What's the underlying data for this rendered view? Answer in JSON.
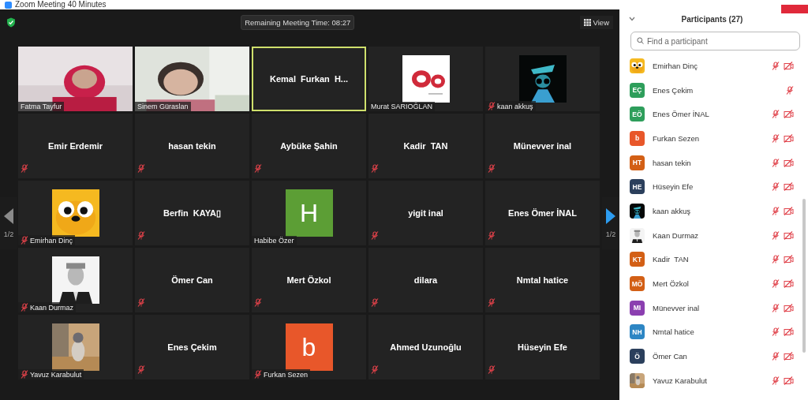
{
  "window": {
    "title": "Zoom Meeting 40 Minutes"
  },
  "top_bar": {
    "timer": "Remaining Meeting Time: 08:27",
    "view_button": "View"
  },
  "pager": {
    "prev": {
      "label": "1/2",
      "disabled": true
    },
    "next": {
      "label": "1/2",
      "disabled": false
    }
  },
  "tiles": [
    {
      "kind": "video",
      "name": "Fatma Tayfur",
      "muted": false,
      "speaking": false
    },
    {
      "kind": "video",
      "name": "Sinem Güraslan",
      "muted": false,
      "speaking": false
    },
    {
      "kind": "name",
      "name": "Kemal  Furkan  H...",
      "muted": false,
      "speaking": true
    },
    {
      "kind": "picture",
      "name": "Murat SARIOĞLAN",
      "muted": false,
      "speaking": false
    },
    {
      "kind": "picture",
      "name": "kaan akkuş",
      "muted": true,
      "speaking": false
    },
    {
      "kind": "name",
      "name": "Emir Erdemir",
      "muted": true,
      "speaking": false
    },
    {
      "kind": "name",
      "name": "hasan tekin",
      "muted": true,
      "speaking": false
    },
    {
      "kind": "name",
      "name": "Aybüke Şahin",
      "muted": true,
      "speaking": false
    },
    {
      "kind": "name",
      "name": "Kadir  TAN",
      "muted": true,
      "speaking": false
    },
    {
      "kind": "name",
      "name": "Münevver inal",
      "muted": true,
      "speaking": false
    },
    {
      "kind": "picture",
      "name": "Emirhan Dinç",
      "muted": true,
      "speaking": false
    },
    {
      "kind": "name",
      "name": "Berfin  KAYA▯",
      "muted": true,
      "speaking": false
    },
    {
      "kind": "letter",
      "letter": "H",
      "color": "#5c9e35",
      "name": "Habibe Özer",
      "muted": false,
      "speaking": false
    },
    {
      "kind": "name",
      "name": "yigit inal",
      "muted": true,
      "speaking": false
    },
    {
      "kind": "name",
      "name": "Enes Ömer İNAL",
      "muted": true,
      "speaking": false
    },
    {
      "kind": "picture",
      "name": "Kaan Durmaz",
      "muted": true,
      "speaking": false
    },
    {
      "kind": "name",
      "name": "Ömer Can",
      "muted": true,
      "speaking": false
    },
    {
      "kind": "name",
      "name": "Mert Özkol",
      "muted": true,
      "speaking": false
    },
    {
      "kind": "name",
      "name": "dilara",
      "muted": true,
      "speaking": false
    },
    {
      "kind": "name",
      "name": "Nmtal hatice",
      "muted": true,
      "speaking": false
    },
    {
      "kind": "picture",
      "name": "Yavuz Karabulut",
      "muted": true,
      "speaking": false
    },
    {
      "kind": "name",
      "name": "Enes Çekim",
      "muted": true,
      "speaking": false
    },
    {
      "kind": "letter",
      "letter": "b",
      "color": "#e8572a",
      "name": "Furkan Sezen",
      "muted": true,
      "speaking": false
    },
    {
      "kind": "name",
      "name": "Ahmed Uzunoğlu",
      "muted": true,
      "speaking": false
    },
    {
      "kind": "name",
      "name": "Hüseyin Efe",
      "muted": true,
      "speaking": false
    }
  ],
  "participants": {
    "title": "Participants (27)",
    "search": {
      "placeholder": "Find a participant"
    },
    "items": [
      {
        "name": "Emirhan Dinç",
        "muted": true,
        "video_off": true
      },
      {
        "name": "Enes Çekim",
        "avatar": {
          "kind": "initials",
          "text": "EÇ",
          "color": "#2e9e5b"
        },
        "muted": true,
        "video_off": false
      },
      {
        "name": "Enes Ömer İNAL",
        "avatar": {
          "kind": "initials",
          "text": "EÖ",
          "color": "#2e9e5b"
        },
        "muted": true,
        "video_off": true
      },
      {
        "name": "Furkan Sezen",
        "avatar": {
          "kind": "initials",
          "text": "b",
          "color": "#e8572a"
        },
        "muted": true,
        "video_off": true
      },
      {
        "name": "hasan tekin",
        "avatar": {
          "kind": "initials",
          "text": "HT",
          "color": "#d35f15"
        },
        "muted": true,
        "video_off": true
      },
      {
        "name": "Hüseyin Efe",
        "avatar": {
          "kind": "initials",
          "text": "HE",
          "color": "#2b3f5c"
        },
        "muted": true,
        "video_off": true
      },
      {
        "name": "kaan akkuş",
        "muted": true,
        "video_off": true
      },
      {
        "name": "Kaan Durmaz",
        "muted": true,
        "video_off": true
      },
      {
        "name": "Kadir  TAN",
        "avatar": {
          "kind": "initials",
          "text": "KT",
          "color": "#d35f15"
        },
        "muted": true,
        "video_off": true
      },
      {
        "name": "Mert Özkol",
        "avatar": {
          "kind": "initials",
          "text": "MÖ",
          "color": "#d35f15"
        },
        "muted": true,
        "video_off": true
      },
      {
        "name": "Münevver inal",
        "avatar": {
          "kind": "initials",
          "text": "MI",
          "color": "#8b3fb0"
        },
        "muted": true,
        "video_off": true
      },
      {
        "name": "Nmtal hatice",
        "avatar": {
          "kind": "initials",
          "text": "NH",
          "color": "#2d86c4"
        },
        "muted": true,
        "video_off": true
      },
      {
        "name": "Ömer Can",
        "avatar": {
          "kind": "initials",
          "text": "Ö",
          "color": "#2b3f5c"
        },
        "muted": true,
        "video_off": true
      },
      {
        "name": "Yavuz Karabulut",
        "muted": true,
        "video_off": true
      }
    ]
  }
}
